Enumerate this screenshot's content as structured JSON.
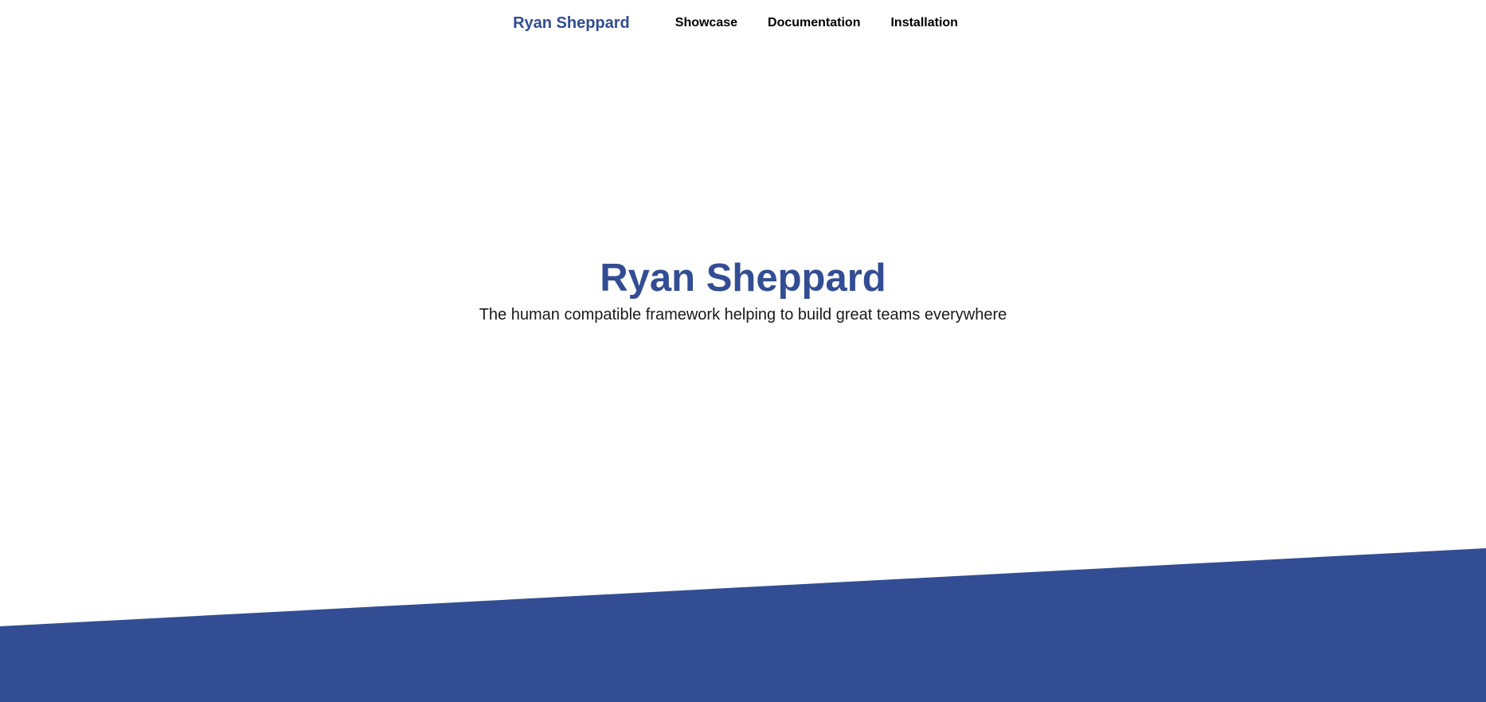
{
  "nav": {
    "brand": "Ryan Sheppard",
    "links": [
      {
        "label": "Showcase"
      },
      {
        "label": "Documentation"
      },
      {
        "label": "Installation"
      }
    ]
  },
  "hero": {
    "title": "Ryan Sheppard",
    "tagline": "The human compatible framework helping to build great teams everywhere"
  },
  "colors": {
    "brand": "#324d93",
    "text": "#000000",
    "background": "#ffffff"
  }
}
